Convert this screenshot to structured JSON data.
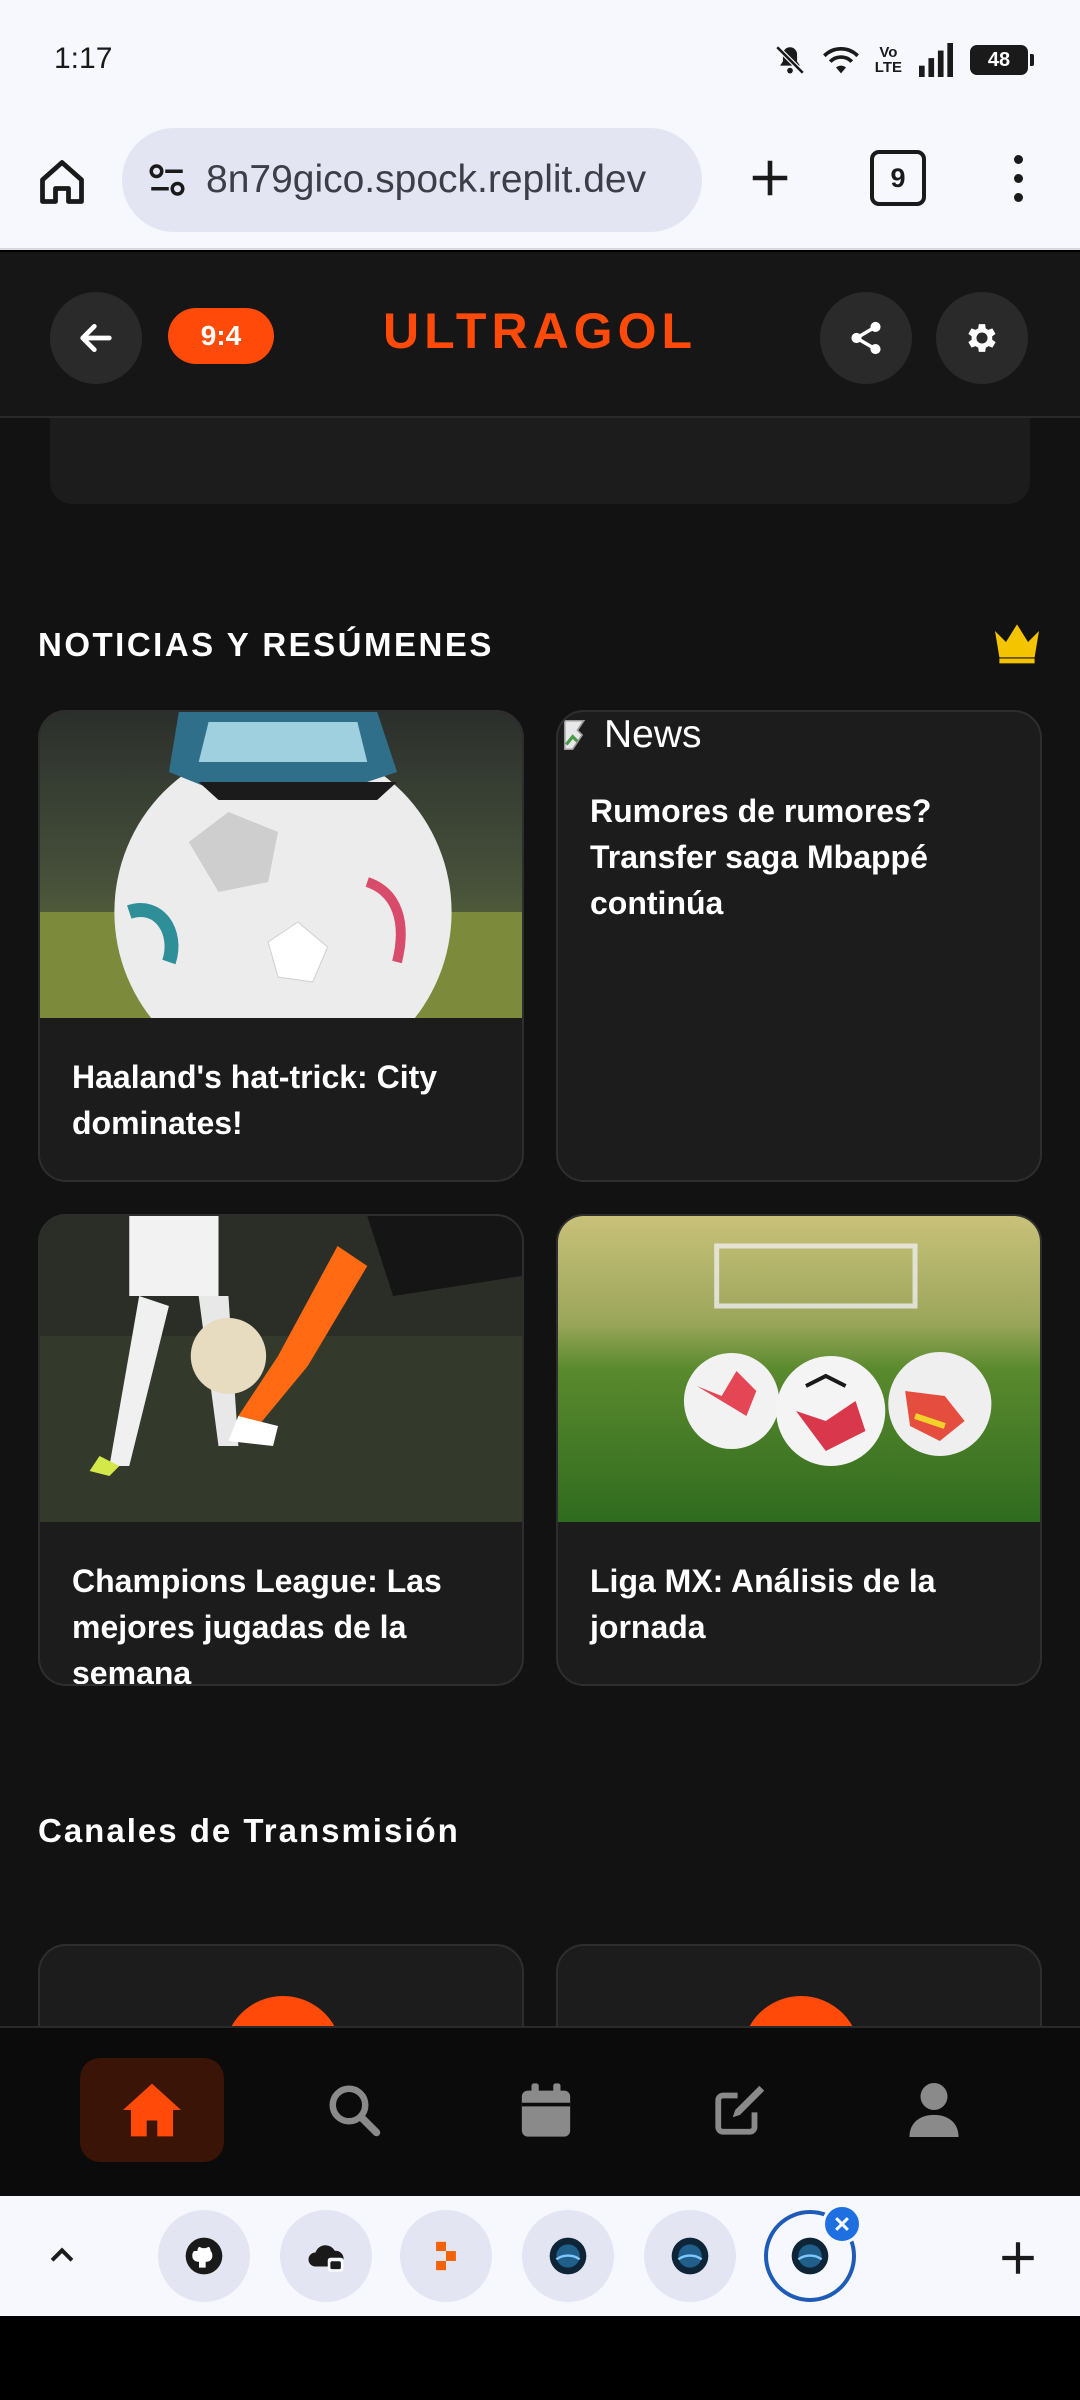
{
  "status_bar": {
    "time": "1:17",
    "battery_level": "48",
    "volte_label_top": "Vo",
    "volte_label_bottom": "LTE"
  },
  "browser": {
    "url": "8n79gico.spock.replit.dev",
    "tab_count": "9"
  },
  "app_header": {
    "score": "9:4",
    "brand": "ULTRAGOL"
  },
  "news_section": {
    "title": "NOTICIAS Y RESÚMENES",
    "cards": [
      {
        "title": "Haaland's hat-trick: City dominates!",
        "image": "ball-on-grass"
      },
      {
        "title": "Rumores de rumores? Transfer saga Mbappé continúa",
        "image_alt": "News"
      },
      {
        "title": "Champions League: Las mejores jugadas de la semana",
        "image": "players-dribbling"
      },
      {
        "title": "Liga MX: Análisis de la jornada",
        "image": "three-balls-field"
      }
    ]
  },
  "channels_section": {
    "title": "Canales de Transmisión"
  },
  "bottom_nav": [
    {
      "icon": "home-icon",
      "active": true
    },
    {
      "icon": "search-icon",
      "active": false
    },
    {
      "icon": "calendar-icon",
      "active": false
    },
    {
      "icon": "edit-icon",
      "active": false
    },
    {
      "icon": "user-icon",
      "active": false
    }
  ],
  "colors": {
    "accent": "#ff4a0a",
    "background": "#121212",
    "card": "#1c1c1c",
    "crown": "#f5c400"
  },
  "tab_strip": {
    "favicons": [
      "github-icon",
      "cloud-lock-icon",
      "replit-icon",
      "sphere-icon",
      "sphere-icon",
      "sphere-icon"
    ]
  }
}
